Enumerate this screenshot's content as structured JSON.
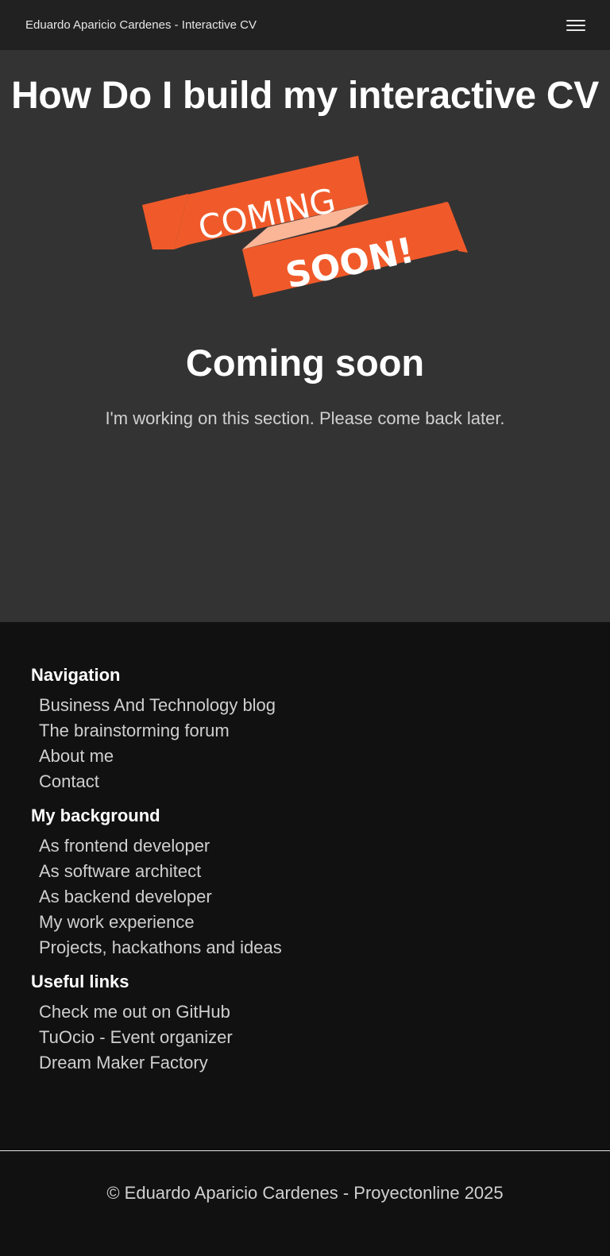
{
  "navbar": {
    "brand": "Eduardo Aparicio Cardenes - Interactive CV",
    "menu_icon": "hamburger-menu-icon"
  },
  "hero": {
    "title": "How Do I build my interactive CV",
    "banner": {
      "word1": "COMING",
      "word2": "SOON!",
      "colors": {
        "ribbon": "#f05a2a",
        "fold": "#fbb597",
        "text": "#ffffff"
      }
    },
    "heading": "Coming soon",
    "message": "I'm working on this section. Please come back later."
  },
  "footer": {
    "sections": [
      {
        "title": "Navigation",
        "links": [
          "Business And Technology blog",
          "The brainstorming forum",
          "About me",
          "Contact"
        ]
      },
      {
        "title": "My background",
        "links": [
          "As frontend developer",
          "As software architect",
          "As backend developer",
          "My work experience",
          "Projects, hackathons and ideas"
        ]
      },
      {
        "title": "Useful links",
        "links": [
          "Check me out on GitHub",
          "TuOcio - Event organizer",
          "Dream Maker Factory"
        ]
      }
    ],
    "copyright": "© Eduardo Aparicio Cardenes - Proyectonline 2025"
  }
}
